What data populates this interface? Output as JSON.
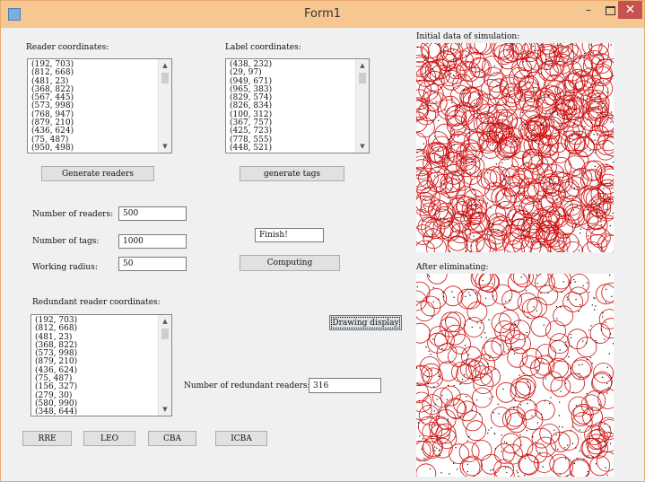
{
  "window": {
    "title": "Form1",
    "minimize_glyph": "–",
    "close_glyph": "✕"
  },
  "reader_section": {
    "label": "Reader coordinates:",
    "items": [
      "(192, 703)",
      "(812, 668)",
      "(481, 23)",
      "(368, 822)",
      "(567, 445)",
      "(573, 998)",
      "(768, 947)",
      "(879, 210)",
      "(436, 624)",
      "(75, 487)",
      "(950, 498)"
    ],
    "button_label": "Generate readers"
  },
  "label_section": {
    "label": "Label coordinates:",
    "items": [
      "(438, 232)",
      "(29, 97)",
      "(949, 671)",
      "(965, 383)",
      "(829, 574)",
      "(826, 834)",
      "(100, 312)",
      "(367, 757)",
      "(425, 723)",
      "(778, 555)",
      "(448, 521)"
    ],
    "button_label": "generate tags"
  },
  "params": {
    "readers_label": "Number of readers:",
    "readers_value": "500",
    "tags_label": "Number of tags:",
    "tags_value": "1000",
    "radius_label": "Working radius:",
    "radius_value": "50"
  },
  "status": {
    "value": "Finish!",
    "computing_label": "Computing"
  },
  "redundant_section": {
    "label": "Redundant reader coordinates:",
    "items": [
      "(192, 703)",
      "(812, 668)",
      "(481, 23)",
      "(368, 822)",
      "(573, 998)",
      "(879, 210)",
      "(436, 624)",
      "(75, 487)",
      "(156, 327)",
      "(279, 30)",
      "(580, 990)",
      "(348, 644)"
    ],
    "drawing_label": "Drawing display",
    "count_label": "Number of redundant readers:",
    "count_value": "316"
  },
  "algorithms": [
    "RRE",
    "LEO",
    "CBA",
    "ICBA"
  ],
  "simulation": {
    "initial_label": "Initial data of simulation:",
    "after_label": "After eliminating:",
    "circle_color": "#cc1111",
    "tag_color": "#000000"
  },
  "scroll_glyphs": {
    "up": "▲",
    "down": "▼"
  }
}
